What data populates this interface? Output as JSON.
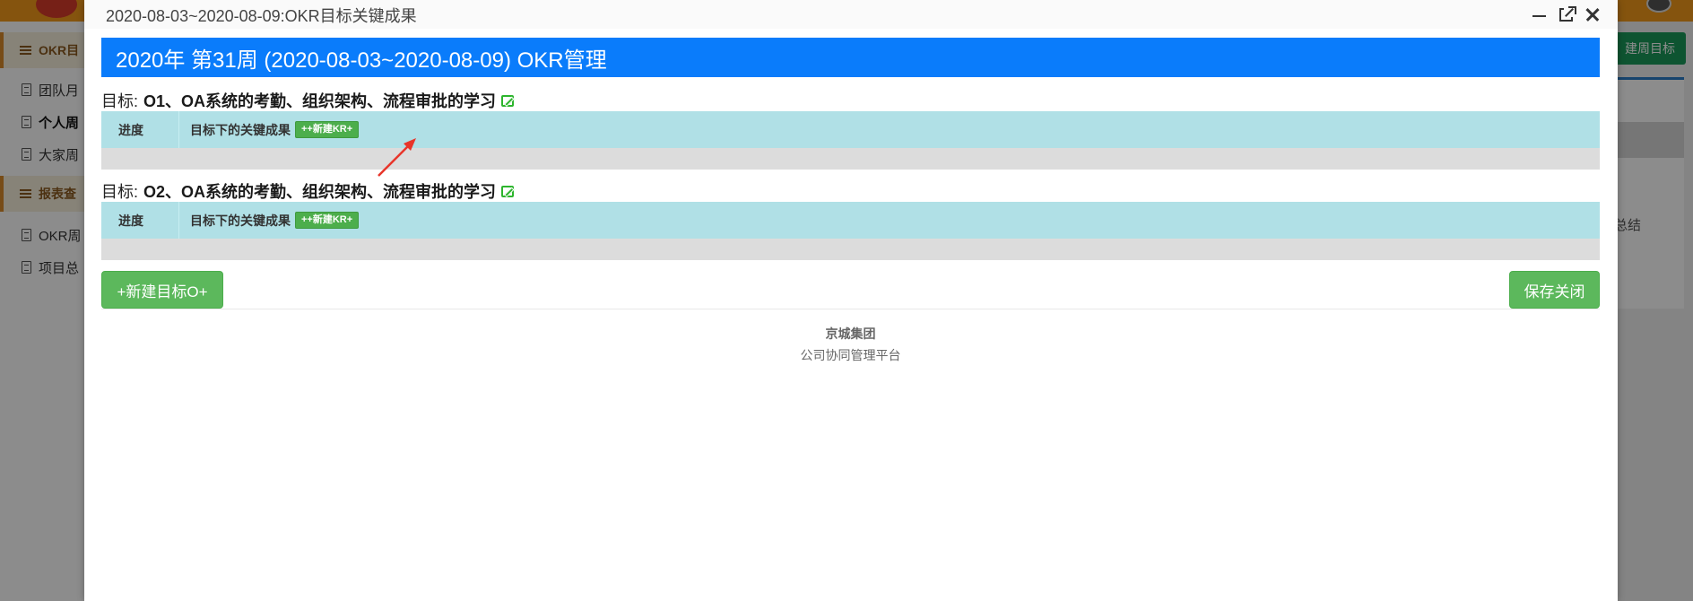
{
  "background": {
    "sidebar": {
      "section1_label": "OKR目",
      "items": [
        "团队月",
        "个人周",
        "大家周"
      ],
      "section2_label": "报表查",
      "items2": [
        "OKR周",
        "项目总"
      ]
    },
    "right_button": "建周目标",
    "right_text": "总结"
  },
  "modal": {
    "title": "2020-08-03~2020-08-09:OKR目标关键成果",
    "header": "2020年 第31周 (2020-08-03~2020-08-09) OKR管理",
    "objectives": [
      {
        "prefix": "目标:",
        "text": "O1、OA系统的考勤、组织架构、流程审批的学习",
        "col_progress": "进度",
        "col_kr": "目标下的关键成果",
        "new_kr": "++新建KR+"
      },
      {
        "prefix": "目标:",
        "text": "O2、OA系统的考勤、组织架构、流程审批的学习",
        "col_progress": "进度",
        "col_kr": "目标下的关键成果",
        "new_kr": "++新建KR+"
      }
    ],
    "new_objective_button": "+新建目标O+",
    "save_close_button": "保存关闭",
    "footer": {
      "company": "京城集团",
      "platform": "公司协同管理平台"
    }
  },
  "colors": {
    "header_blue": "#0a7cfb",
    "table_head": "#b0e0e6",
    "button_green": "#5cb85c",
    "annotation_arrow": "#e8352a"
  }
}
